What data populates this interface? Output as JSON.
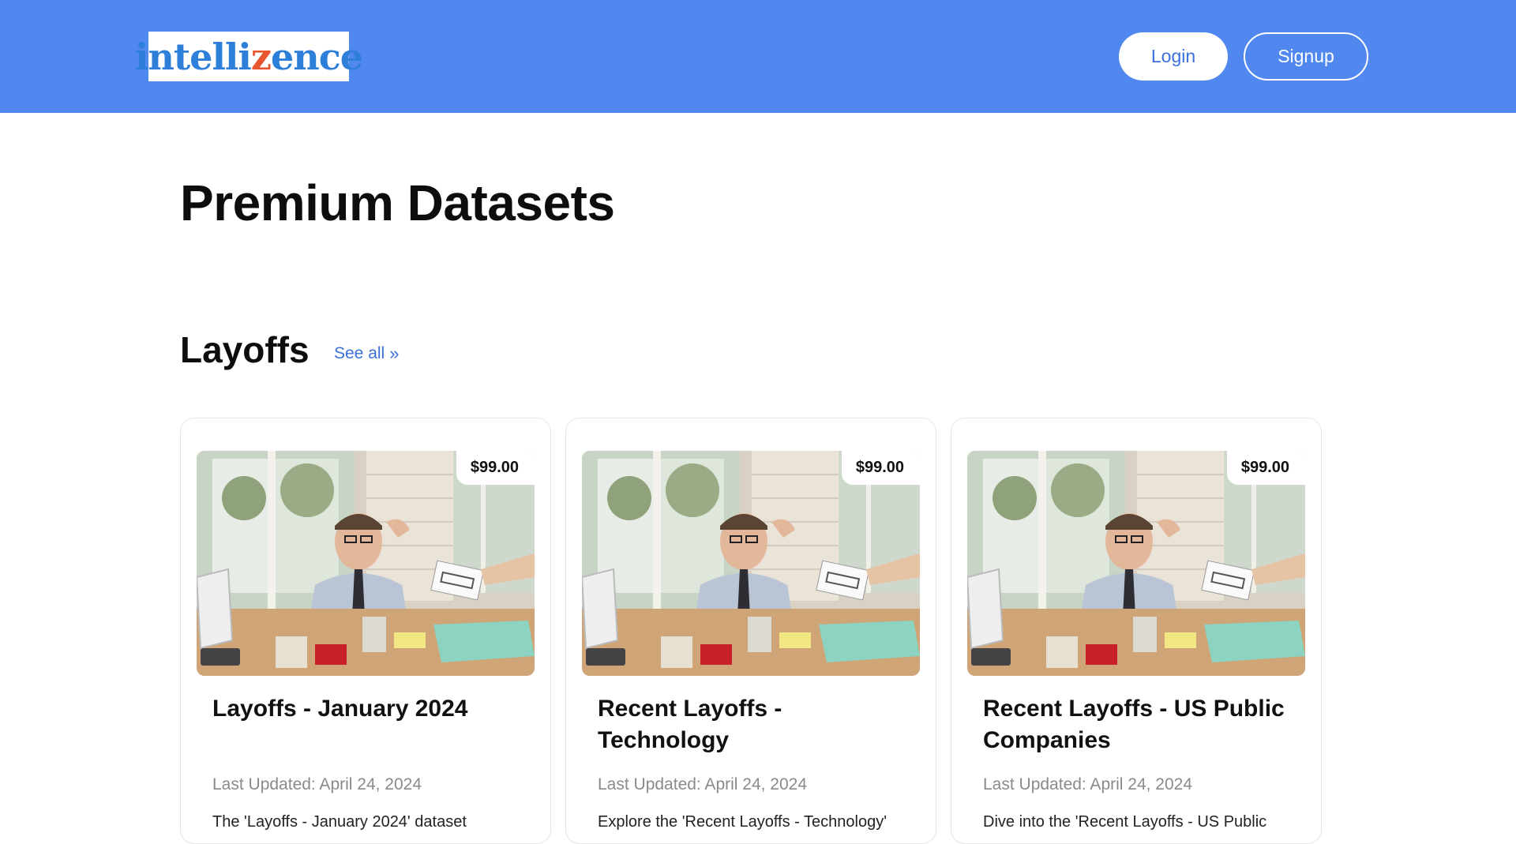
{
  "header": {
    "logo_part1": "intelli",
    "logo_part2": "z",
    "logo_part3": "ence",
    "login_label": "Login",
    "signup_label": "Signup",
    "colors": {
      "bar": "#5088f0",
      "logo_blue": "#2e7fd9",
      "logo_orange": "#e8562f"
    }
  },
  "main": {
    "title": "Premium Datasets",
    "section": {
      "title": "Layoffs",
      "see_all_label": "See all",
      "see_all_icon": "double-chevron-right-icon"
    }
  },
  "cards": [
    {
      "price": "$99.00",
      "title": "Layoffs - January 2024",
      "updated": "Last Updated: April 24, 2024",
      "description": "The 'Layoffs - January 2024' dataset"
    },
    {
      "price": "$99.00",
      "title": "Recent Layoffs - Technology",
      "updated": "Last Updated: April 24, 2024",
      "description": "Explore the 'Recent Layoffs - Technology'"
    },
    {
      "price": "$99.00",
      "title": "Recent Layoffs - US Public Companies",
      "updated": "Last Updated: April 24, 2024",
      "description": "Dive into the 'Recent Layoffs - US Public"
    }
  ]
}
